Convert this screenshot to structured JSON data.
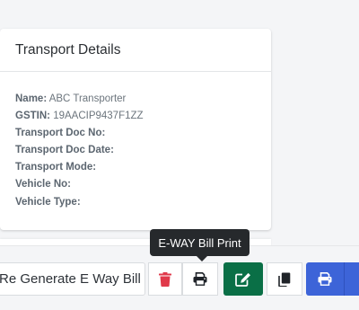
{
  "card": {
    "title": "Transport Details",
    "fields": [
      {
        "label": "Name:",
        "value": "ABC Transporter"
      },
      {
        "label": "GSTIN:",
        "value": "19AACIP9437F1ZZ"
      },
      {
        "label": "Transport Doc No:",
        "value": ""
      },
      {
        "label": "Transport Doc Date:",
        "value": ""
      },
      {
        "label": "Transport Mode:",
        "value": ""
      },
      {
        "label": "Vehicle No:",
        "value": ""
      },
      {
        "label": "Vehicle Type:",
        "value": ""
      }
    ]
  },
  "toolbar": {
    "regenerate_label": "Re Generate E Way Bill",
    "tooltip": "E-WAY Bill Print"
  },
  "colors": {
    "delete": "#e0394a",
    "edit": "#0a6f46",
    "print_primary": "#3d64d8"
  },
  "icons": [
    "trash-icon",
    "printer-icon",
    "edit-icon",
    "copy-icon",
    "printer-icon"
  ]
}
